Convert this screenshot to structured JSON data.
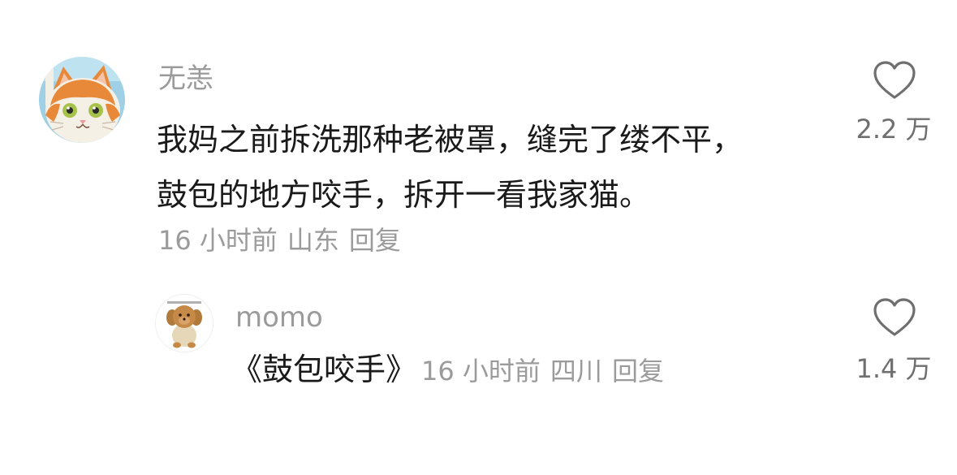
{
  "comment": {
    "username": "无恙",
    "text_lines": [
      "我妈之前拆洗那种老被罩，缝完了缕不平，",
      "鼓包的地方咬手，拆开一看我家猫。"
    ],
    "time": "16 小时前",
    "location": "山东",
    "reply_label": "回复",
    "likes": "2.2 万",
    "avatar_icon": "orange-cat-avatar"
  },
  "reply": {
    "username": "momo",
    "text": "《鼓包咬手》",
    "time": "16 小时前",
    "location": "四川",
    "reply_label": "回复",
    "likes": "1.4 万",
    "avatar_icon": "toy-dog-avatar"
  },
  "colors": {
    "text": "#1a1a1a",
    "muted": "#9b9b9b",
    "icon": "#6f6f6f",
    "background": "#ffffff"
  }
}
